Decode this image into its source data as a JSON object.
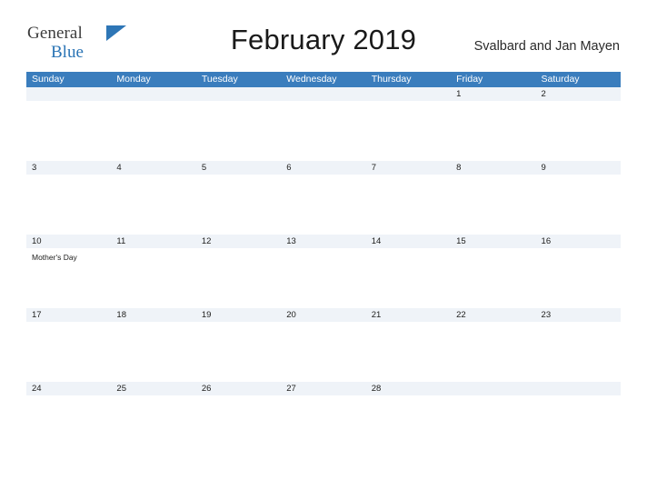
{
  "logo": {
    "word_one": "General",
    "word_two": "Blue",
    "flag_icon": "triangle-flag-icon"
  },
  "header": {
    "title": "February 2019",
    "region": "Svalbard and Jan Mayen"
  },
  "calendar": {
    "weekdays": [
      "Sunday",
      "Monday",
      "Tuesday",
      "Wednesday",
      "Thursday",
      "Friday",
      "Saturday"
    ],
    "accent_color": "#3a7dbd",
    "row_stripe_color": "#eff3f8",
    "row_line_color": "#2f6fad",
    "weeks": [
      [
        {
          "day": "",
          "event": ""
        },
        {
          "day": "",
          "event": ""
        },
        {
          "day": "",
          "event": ""
        },
        {
          "day": "",
          "event": ""
        },
        {
          "day": "",
          "event": ""
        },
        {
          "day": "1",
          "event": ""
        },
        {
          "day": "2",
          "event": ""
        }
      ],
      [
        {
          "day": "3",
          "event": ""
        },
        {
          "day": "4",
          "event": ""
        },
        {
          "day": "5",
          "event": ""
        },
        {
          "day": "6",
          "event": ""
        },
        {
          "day": "7",
          "event": ""
        },
        {
          "day": "8",
          "event": ""
        },
        {
          "day": "9",
          "event": ""
        }
      ],
      [
        {
          "day": "10",
          "event": "Mother's Day"
        },
        {
          "day": "11",
          "event": ""
        },
        {
          "day": "12",
          "event": ""
        },
        {
          "day": "13",
          "event": ""
        },
        {
          "day": "14",
          "event": ""
        },
        {
          "day": "15",
          "event": ""
        },
        {
          "day": "16",
          "event": ""
        }
      ],
      [
        {
          "day": "17",
          "event": ""
        },
        {
          "day": "18",
          "event": ""
        },
        {
          "day": "19",
          "event": ""
        },
        {
          "day": "20",
          "event": ""
        },
        {
          "day": "21",
          "event": ""
        },
        {
          "day": "22",
          "event": ""
        },
        {
          "day": "23",
          "event": ""
        }
      ],
      [
        {
          "day": "24",
          "event": ""
        },
        {
          "day": "25",
          "event": ""
        },
        {
          "day": "26",
          "event": ""
        },
        {
          "day": "27",
          "event": ""
        },
        {
          "day": "28",
          "event": ""
        },
        {
          "day": "",
          "event": ""
        },
        {
          "day": "",
          "event": ""
        }
      ]
    ]
  }
}
